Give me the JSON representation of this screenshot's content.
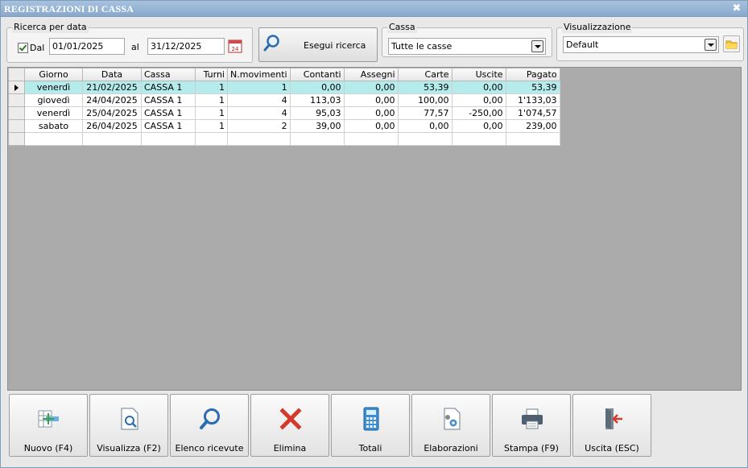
{
  "window": {
    "title": "REGISTRAZIONI DI CASSA",
    "close_glyph": "✖"
  },
  "search_by_date": {
    "legend": "Ricerca per data",
    "checkbox_label": "Dal",
    "checked": true,
    "from_value": "01/01/2025",
    "to_label": "al",
    "to_value": "31/12/2025",
    "calendar_icon_text": "24"
  },
  "search_button": {
    "label": "Esegui ricerca",
    "icon": "search-icon"
  },
  "cassa": {
    "legend": "Cassa",
    "selected": "Tutte le casse"
  },
  "visualizzazione": {
    "legend": "Visualizzazione",
    "selected": "Default",
    "icon": "folder-icon"
  },
  "grid": {
    "columns": [
      "Giorno",
      "Data",
      "Cassa",
      "Turni",
      "N.movimenti",
      "Contanti",
      "Assegni",
      "Carte",
      "Uscite",
      "Pagato"
    ],
    "rows": [
      [
        "venerdì",
        "21/02/2025",
        "CASSA 1",
        "1",
        "1",
        "0,00",
        "0,00",
        "53,39",
        "0,00",
        "53,39"
      ],
      [
        "giovedì",
        "24/04/2025",
        "CASSA 1",
        "1",
        "4",
        "113,03",
        "0,00",
        "100,00",
        "0,00",
        "1'133,03"
      ],
      [
        "venerdì",
        "25/04/2025",
        "CASSA 1",
        "1",
        "4",
        "95,03",
        "0,00",
        "77,57",
        "-250,00",
        "1'074,57"
      ],
      [
        "sabato",
        "26/04/2025",
        "CASSA 1",
        "1",
        "2",
        "39,00",
        "0,00",
        "0,00",
        "0,00",
        "239,00"
      ]
    ],
    "selected_row": 0
  },
  "toolbar": [
    {
      "label": "Nuovo (F4)",
      "icon": "new-record-icon"
    },
    {
      "label": "Visualizza (F2)",
      "icon": "view-document-icon"
    },
    {
      "label": "Elenco ricevute",
      "icon": "search-icon"
    },
    {
      "label": "Elimina",
      "icon": "delete-x-icon"
    },
    {
      "label": "Totali",
      "icon": "calculator-icon"
    },
    {
      "label": "Elaborazioni",
      "icon": "document-gear-icon"
    },
    {
      "label": "Stampa (F9)",
      "icon": "printer-icon"
    },
    {
      "label": "Uscita (ESC)",
      "icon": "exit-door-icon"
    }
  ]
}
